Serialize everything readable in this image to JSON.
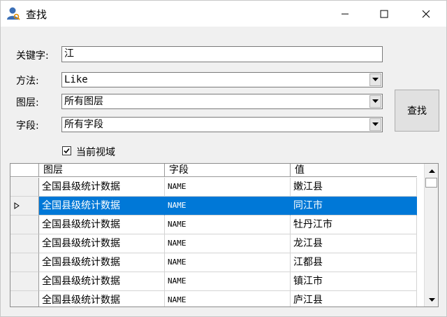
{
  "window": {
    "title": "查找",
    "icon": "user-search-icon"
  },
  "form": {
    "keyword_label": "关键字:",
    "keyword_value": "江",
    "method_label": "方法:",
    "method_value": "Like",
    "layer_label": "图层:",
    "layer_value": "所有图层",
    "field_label": "字段:",
    "field_value": "所有字段",
    "find_button": "查找",
    "current_view_label": "当前视域",
    "current_view_checked": true
  },
  "grid": {
    "columns": [
      "图层",
      "字段",
      "值"
    ],
    "selected_index": 1,
    "rows": [
      {
        "layer": "全国县级统计数据",
        "field": "NAME",
        "value": "嫩江县"
      },
      {
        "layer": "全国县级统计数据",
        "field": "NAME",
        "value": "同江市"
      },
      {
        "layer": "全国县级统计数据",
        "field": "NAME",
        "value": "牡丹江市"
      },
      {
        "layer": "全国县级统计数据",
        "field": "NAME",
        "value": "龙江县"
      },
      {
        "layer": "全国县级统计数据",
        "field": "NAME",
        "value": "江都县"
      },
      {
        "layer": "全国县级统计数据",
        "field": "NAME",
        "value": "镇江市"
      },
      {
        "layer": "全国县级统计数据",
        "field": "NAME",
        "value": "庐江县"
      }
    ]
  }
}
